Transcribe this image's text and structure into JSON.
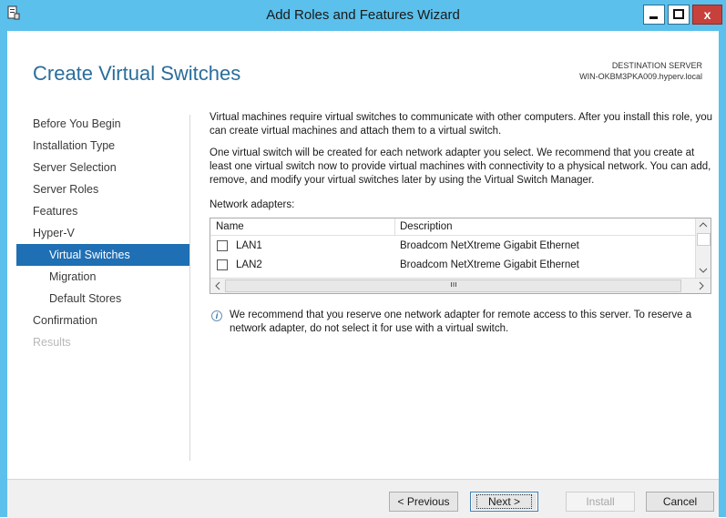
{
  "window": {
    "title": "Add Roles and Features Wizard",
    "close_glyph": "x"
  },
  "page": {
    "title": "Create Virtual Switches",
    "destination_label": "DESTINATION SERVER",
    "destination_server": "WIN-OKBM3PKA009.hyperv.local"
  },
  "nav": {
    "items": [
      {
        "label": "Before You Begin"
      },
      {
        "label": "Installation Type"
      },
      {
        "label": "Server Selection"
      },
      {
        "label": "Server Roles"
      },
      {
        "label": "Features"
      },
      {
        "label": "Hyper-V"
      },
      {
        "label": "Virtual Switches"
      },
      {
        "label": "Migration"
      },
      {
        "label": "Default Stores"
      },
      {
        "label": "Confirmation"
      },
      {
        "label": "Results"
      }
    ]
  },
  "main": {
    "para1": "Virtual machines require virtual switches to communicate with other computers. After you install this role, you can create virtual machines and attach them to a virtual switch.",
    "para2": "One virtual switch will be created for each network adapter you select. We recommend that you create at least one virtual switch now to provide virtual machines with connectivity to a physical network. You can add, remove, and modify your virtual switches later by using the Virtual Switch Manager.",
    "adapters_label": "Network adapters:",
    "columns": {
      "name": "Name",
      "description": "Description"
    },
    "rows": [
      {
        "name": "LAN1",
        "description": "Broadcom NetXtreme Gigabit Ethernet",
        "checked": false
      },
      {
        "name": "LAN2",
        "description": "Broadcom NetXtreme Gigabit Ethernet",
        "checked": false
      }
    ],
    "info": "We recommend that you reserve one network adapter for remote access to this server. To reserve a network adapter, do not select it for use with a virtual switch."
  },
  "footer": {
    "previous": "< Previous",
    "next": "Next >",
    "install": "Install",
    "cancel": "Cancel"
  }
}
